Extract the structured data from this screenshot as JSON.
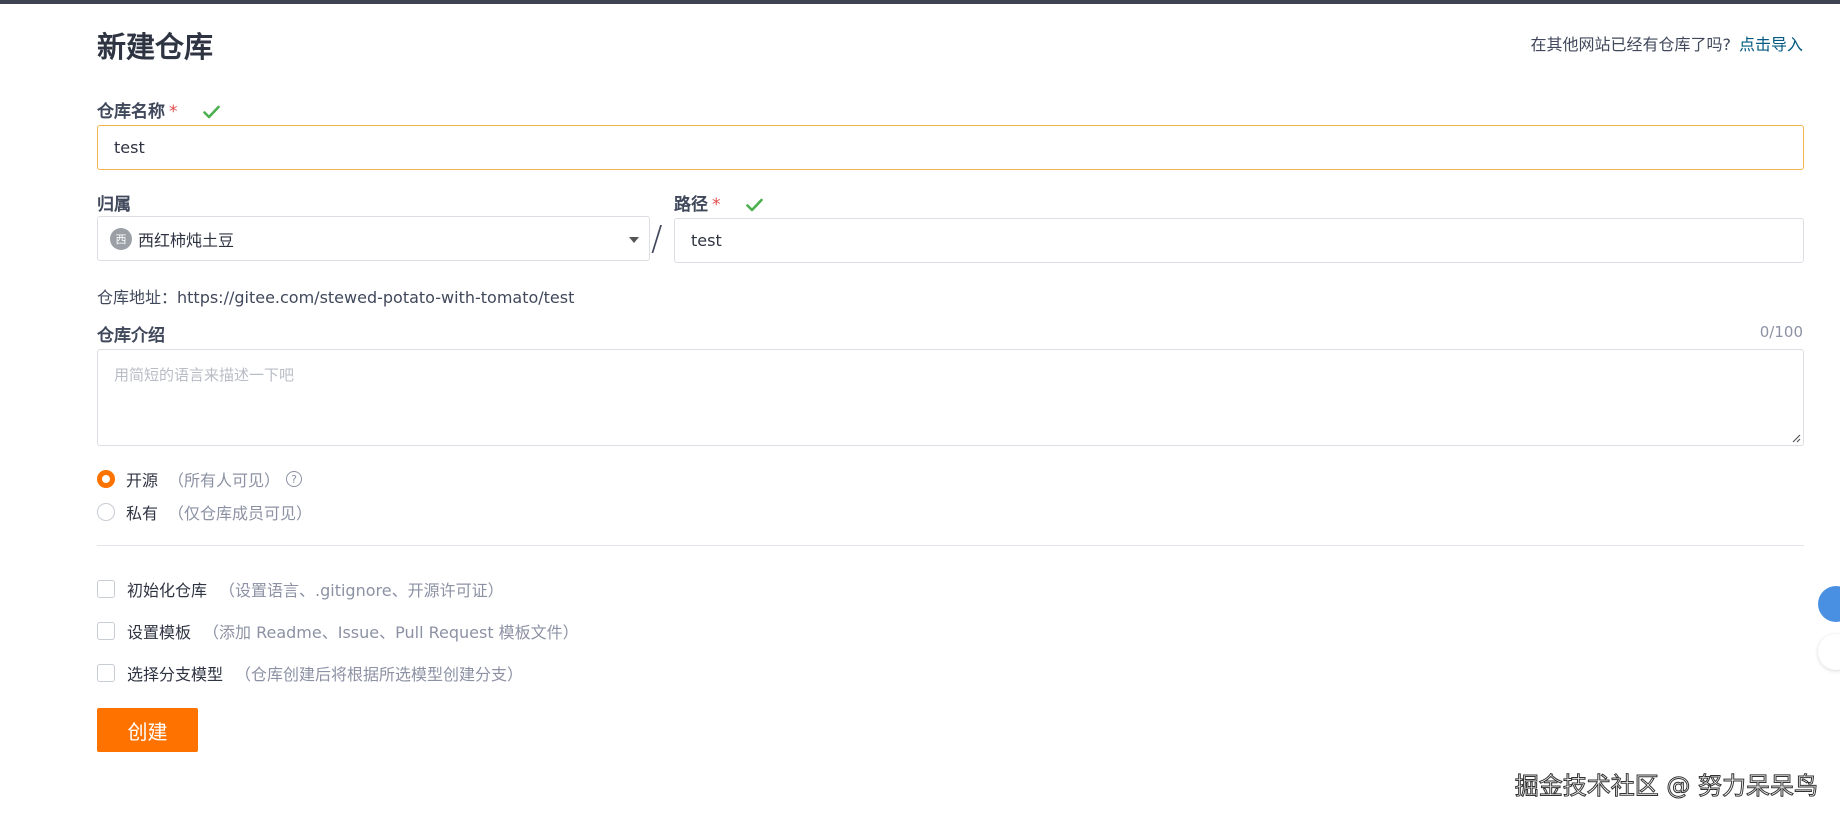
{
  "page": {
    "title": "新建仓库",
    "import_prompt": "在其他网站已经有仓库了吗?",
    "import_link": "点击导入"
  },
  "repo_name": {
    "label": "仓库名称",
    "required_mark": "*",
    "value": "test"
  },
  "owner": {
    "label": "归属",
    "avatar_text": "西",
    "selected": "西红柿炖土豆"
  },
  "separator": "/",
  "path": {
    "label": "路径",
    "required_mark": "*",
    "value": "test"
  },
  "address": {
    "text": "仓库地址：https://gitee.com/stewed-potato-with-tomato/test"
  },
  "description": {
    "label": "仓库介绍",
    "counter": "0/100",
    "placeholder": "用简短的语言来描述一下吧"
  },
  "visibility": {
    "help_glyph": "?",
    "options": [
      {
        "label": "开源",
        "hint": "（所有人可见）",
        "selected": true
      },
      {
        "label": "私有",
        "hint": "（仅仓库成员可见）",
        "selected": false
      }
    ]
  },
  "options": [
    {
      "label": "初始化仓库",
      "hint": "（设置语言、.gitignore、开源许可证）",
      "checked": false
    },
    {
      "label": "设置模板",
      "hint": "（添加 Readme、Issue、Pull Request 模板文件）",
      "checked": false
    },
    {
      "label": "选择分支模型",
      "hint": "（仓库创建后将根据所选模型创建分支）",
      "checked": false
    }
  ],
  "submit_label": "创建",
  "watermark": "掘金技术社区 @ 努力呆呆鸟",
  "colors": {
    "accent": "#fe7300",
    "focus_border": "#f4b54e",
    "link": "#005980",
    "check": "#4caf50",
    "required": "#e14c4c"
  }
}
